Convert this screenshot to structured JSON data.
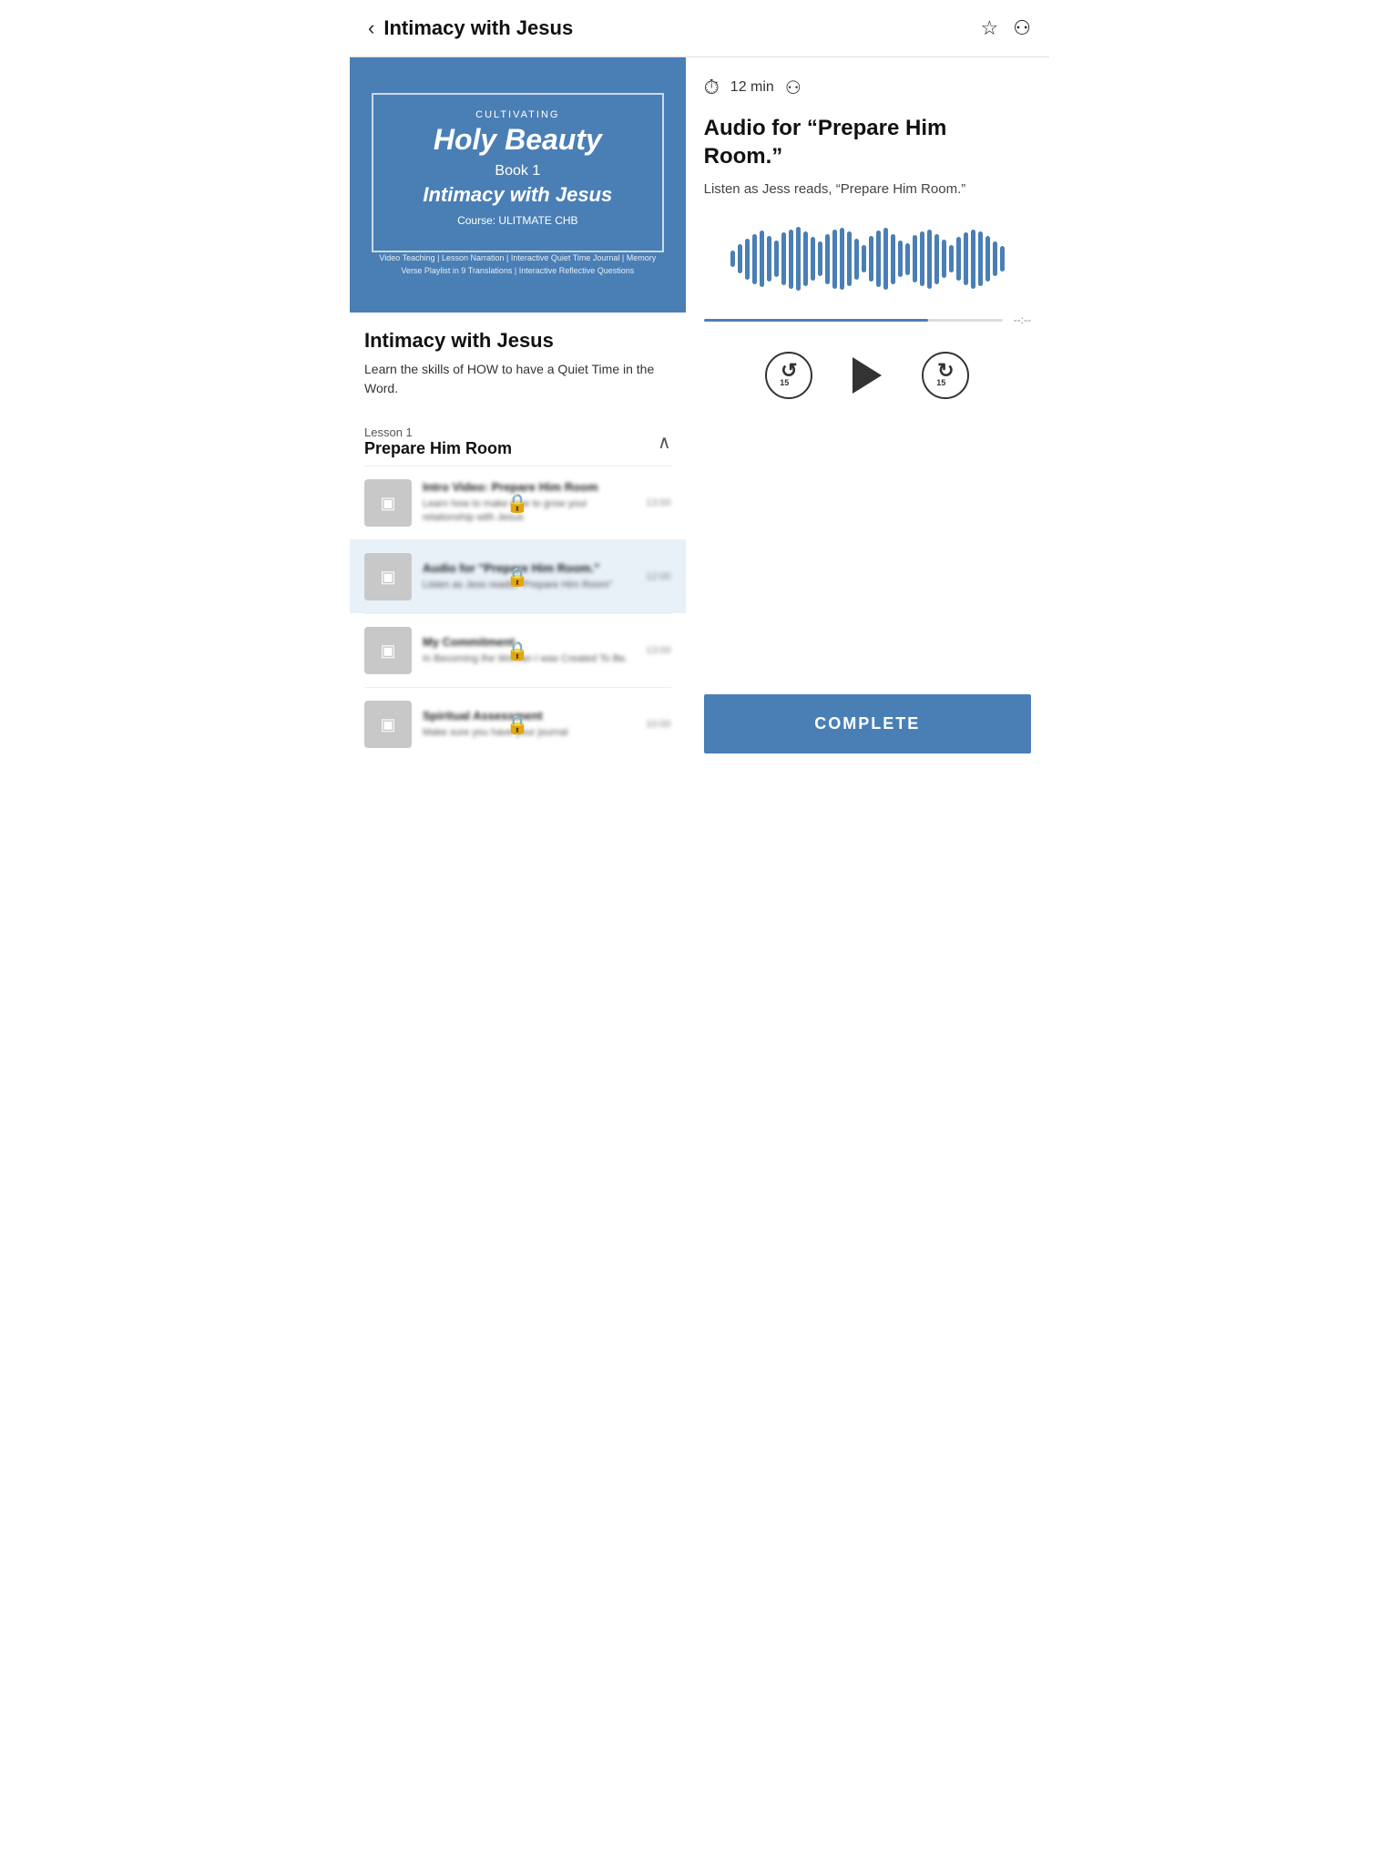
{
  "header": {
    "title": "Intimacy with Jesus",
    "back_label": "‹",
    "bookmark_icon": "☆",
    "link_icon": "⚇"
  },
  "course_image": {
    "cultivating": "CULTIVATING",
    "holy_beauty": "Holy Beauty",
    "book1": "Book 1",
    "intimacy": "Intimacy with Jesus",
    "course_code": "Course: ULITMATE CHB",
    "features": "Video Teaching | Lesson Narration | Interactive Quiet Time Journal |\nMemory Verse Playlist in 9 Translations | Interactive Reflective Questions"
  },
  "course_info": {
    "title": "Intimacy with Jesus",
    "description": "Learn the skills of HOW to have a Quiet Time in the Word."
  },
  "lesson": {
    "label": "Lesson 1",
    "name": "Prepare Him Room",
    "chevron": "∧"
  },
  "lesson_items": [
    {
      "title": "Intro Video: Prepare Him Room",
      "description": "Learn how to make time to grow your relationship with Jesus",
      "duration": "13:00",
      "locked": true,
      "active": false
    },
    {
      "title": "Audio for \"Prepare Him Room.\"",
      "description": "Listen as Jess reads, \"Prepare Him Room\"",
      "duration": "12:00",
      "locked": true,
      "active": true
    },
    {
      "title": "My Commitment",
      "description": "In Becoming the Woman I was Created To Be.",
      "duration": "13:00",
      "locked": true,
      "active": false
    },
    {
      "title": "Spiritual Assessment",
      "description": "Make sure you have your journal",
      "duration": "10:00",
      "locked": true,
      "active": false
    }
  ],
  "audio_player": {
    "duration": "12 min",
    "title": "Audio for “Prepare Him Room.”",
    "description": "Listen as Jess reads, “Prepare Him Room.”",
    "progress_time": "--:--",
    "rewind_label": "15",
    "forward_label": "15",
    "accent_color": "#4a7fb5"
  },
  "complete_button": {
    "label": "COMPLETE"
  },
  "waveform": {
    "bars": [
      18,
      32,
      45,
      55,
      62,
      50,
      40,
      58,
      65,
      70,
      60,
      48,
      38,
      55,
      65,
      68,
      60,
      45,
      30,
      50,
      62,
      68,
      55,
      40,
      35,
      52,
      60,
      65,
      55,
      42,
      30,
      48,
      58,
      65,
      60,
      50,
      38,
      28
    ]
  }
}
